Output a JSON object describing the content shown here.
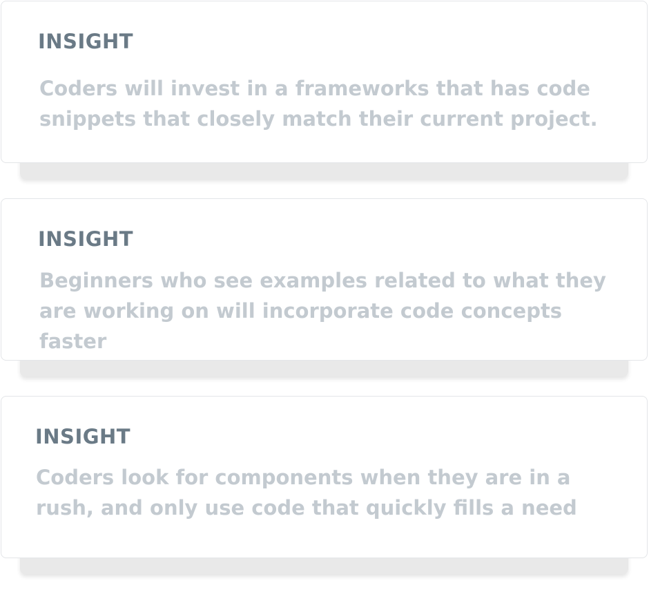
{
  "cards": [
    {
      "label": "INSIGHT",
      "text": "Coders will invest in a frameworks that has code snippets that closely match their current project."
    },
    {
      "label": "INSIGHT",
      "text": "Beginners who see examples related to what they are working on will incorporate code concepts faster"
    },
    {
      "label": "INSIGHT",
      "text": "Coders look for components when they are in a rush, and only use code that quickly fills a need"
    }
  ],
  "colors": {
    "label": "#6a7a86",
    "text": "#c3cad0",
    "card_border": "#e3e5e8",
    "shadow_strip": "#e9e9e9"
  }
}
